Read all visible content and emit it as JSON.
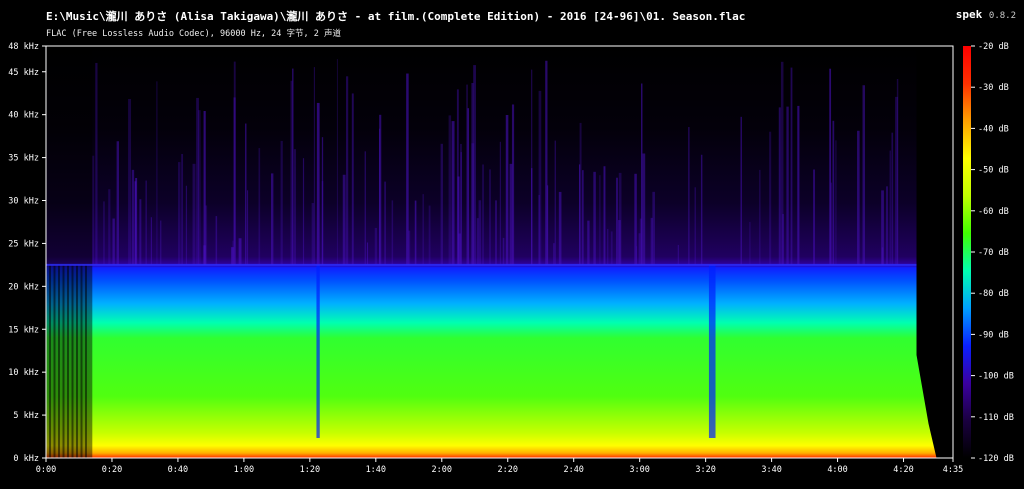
{
  "window": {
    "file_path": "E:\\Music\\瀧川 ありさ (Alisa Takigawa)\\瀧川 ありさ - at film.(Complete Edition) - 2016 [24-96]\\01. Season.flac",
    "file_info": "FLAC (Free Lossless Audio Codec), 96000 Hz, 24 字节, 2 声道",
    "app_name": "spek",
    "app_version": "0.8.2"
  },
  "chart_data": {
    "type": "heatmap",
    "title": "",
    "xlabel": "",
    "ylabel": "",
    "x_ticks": [
      "0:00",
      "0:20",
      "0:40",
      "1:00",
      "1:20",
      "1:40",
      "2:00",
      "2:20",
      "2:40",
      "3:00",
      "3:20",
      "3:40",
      "4:00",
      "4:20",
      "4:35"
    ],
    "x_tick_seconds": [
      0,
      20,
      40,
      60,
      80,
      100,
      120,
      140,
      160,
      180,
      200,
      220,
      240,
      260,
      275
    ],
    "xlim_seconds": [
      0,
      275
    ],
    "y_ticks": [
      "0 kHz",
      "5 kHz",
      "10 kHz",
      "15 kHz",
      "20 kHz",
      "25 kHz",
      "30 kHz",
      "35 kHz",
      "40 kHz",
      "45 kHz",
      "48 kHz"
    ],
    "y_tick_khz": [
      0,
      5,
      10,
      15,
      20,
      25,
      30,
      35,
      40,
      45,
      48
    ],
    "ylim_khz": [
      0,
      48
    ],
    "colorbar_ticks": [
      "-20 dB",
      "-30 dB",
      "-40 dB",
      "-50 dB",
      "-60 dB",
      "-70 dB",
      "-80 dB",
      "-90 dB",
      "-100 dB",
      "-110 dB",
      "-120 dB"
    ],
    "colorbar_db": [
      -20,
      -30,
      -40,
      -50,
      -60,
      -70,
      -80,
      -90,
      -100,
      -110,
      -120
    ],
    "colorbar_range_db": [
      -120,
      -20
    ],
    "colormap": [
      "#000000",
      "#1a0040",
      "#3a00a0",
      "#0a20ff",
      "#00a0ff",
      "#00ffb0",
      "#40ff00",
      "#c0ff00",
      "#ffff00",
      "#ffa000",
      "#ff3000",
      "#ff0000"
    ],
    "cutoff_khz": 22.5,
    "content_end_seconds": 270,
    "quiet_sections_seconds": [
      [
        0,
        14
      ],
      [
        82,
        83
      ],
      [
        201,
        203
      ]
    ]
  }
}
